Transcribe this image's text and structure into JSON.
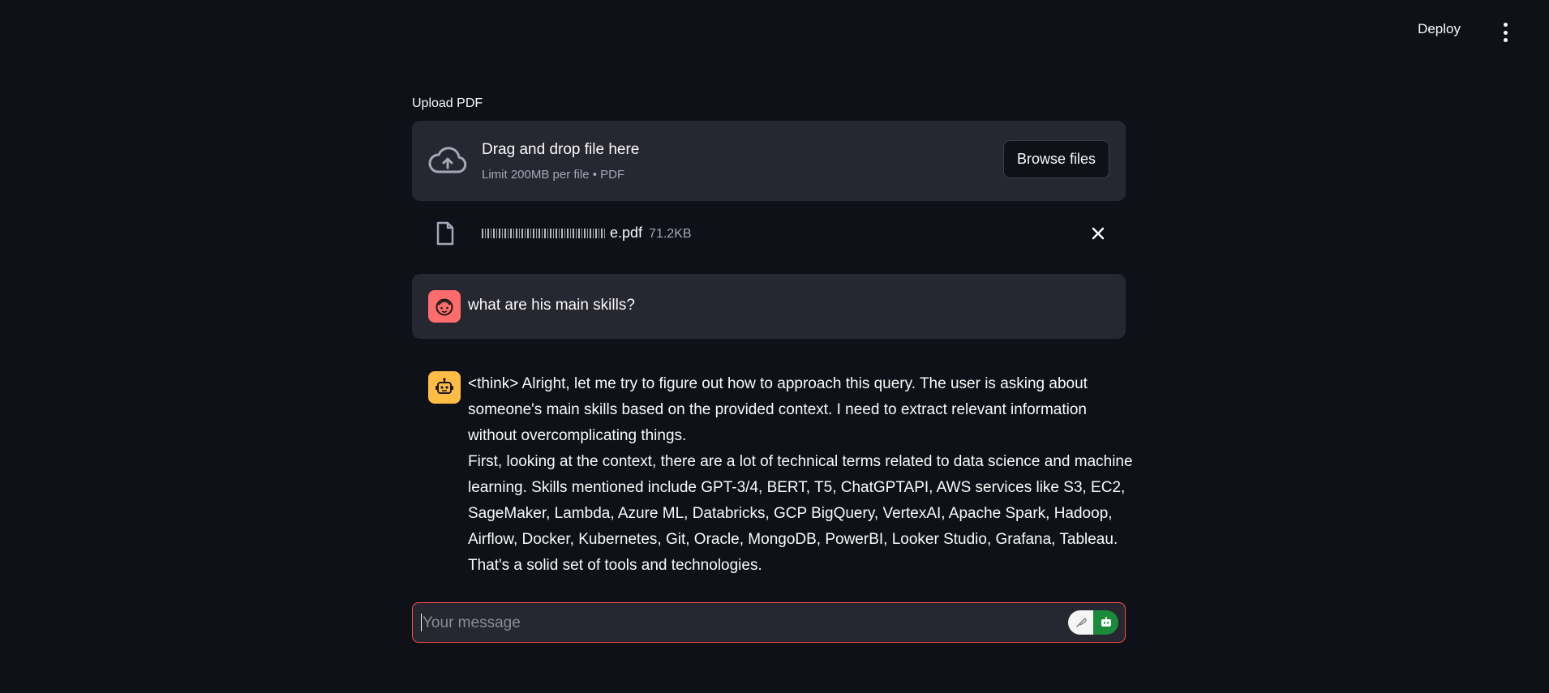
{
  "header": {
    "deploy_label": "Deploy",
    "menu_icon": "vertical-ellipsis-icon"
  },
  "uploader": {
    "label": "Upload PDF",
    "drop_title": "Drag and drop file here",
    "drop_limit": "Limit 200MB per file • PDF",
    "browse_label": "Browse files",
    "icon": "cloud-upload-icon"
  },
  "uploaded_file": {
    "name_suffix": "e.pdf",
    "size": "71.2KB",
    "icon": "file-icon",
    "remove_icon": "close-icon"
  },
  "messages": {
    "user": {
      "text": "what are his main skills?",
      "avatar_icon": "user-face-icon",
      "avatar_color": "#ff6c6c"
    },
    "assistant": {
      "avatar_icon": "robot-icon",
      "avatar_color": "#ffbd45",
      "paragraph_1": "<think> Alright, let me try to figure out how to approach this query. The user is asking about someone's main skills based on the provided context. I need to extract relevant information without overcomplicating things.",
      "paragraph_2": "First, looking at the context, there are a lot of technical terms related to data science and machine learning. Skills mentioned include GPT-3/4, BERT, T5, ChatGPTAPI, AWS services like S3, EC2, SageMaker, Lambda, Azure ML, Databricks, GCP BigQuery, VertexAI, Apache Spark, Hadoop, Airflow, Docker, Kubernetes, Git, Oracle, MongoDB, PowerBI, Looker Studio, Grafana, Tableau. That's a solid set of tools and technologies."
    }
  },
  "chat_input": {
    "placeholder": "Your message",
    "value": "",
    "border_color": "#ff4b4b",
    "toggle_left_icon": "feather-icon",
    "toggle_right_icon": "robot-icon",
    "toggle_active_color": "#1b8a3a"
  },
  "colors": {
    "background": "#0e1117",
    "surface": "#262730",
    "text": "#fafafa",
    "muted": "#a3a8b8"
  }
}
